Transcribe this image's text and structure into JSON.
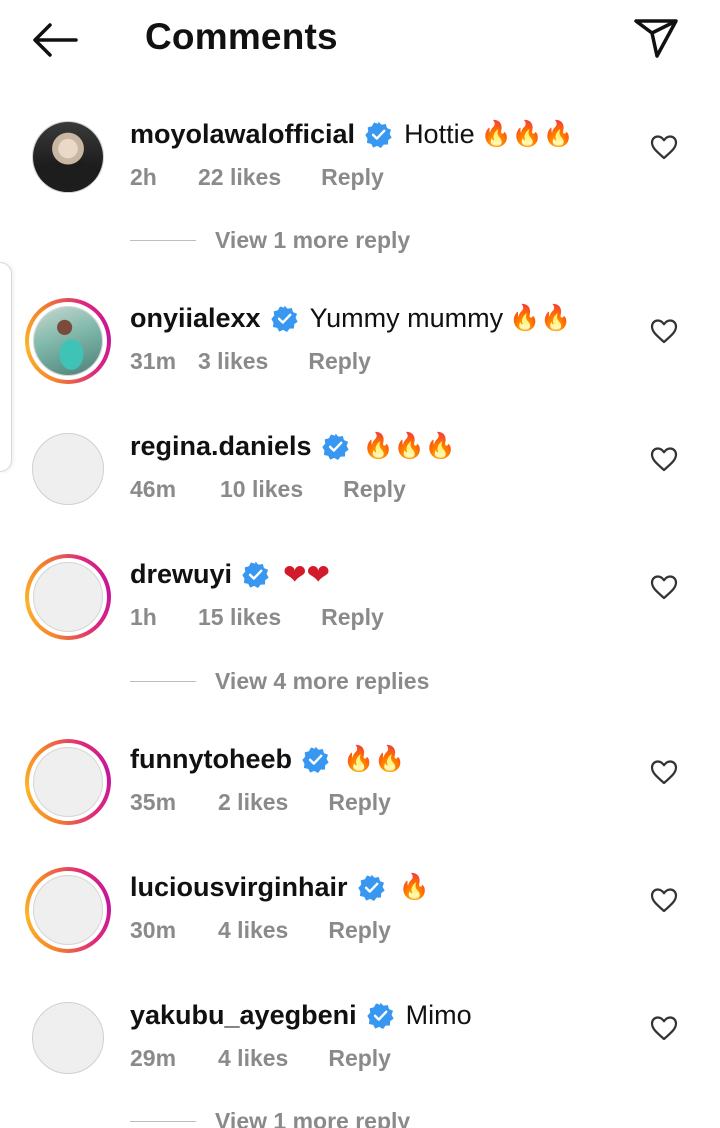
{
  "header": {
    "title": "Comments",
    "back_icon": "arrow-left-icon",
    "send_icon": "paper-plane-icon"
  },
  "colors": {
    "verified_badge": "#3897f0",
    "secondary_text": "#8a8a8a",
    "story_ring_start": "#f58529",
    "story_ring_end": "#c4159b"
  },
  "comments": [
    {
      "username": "moyolawalofficial",
      "verified": true,
      "text": "Hottie",
      "emoji": "🔥🔥🔥",
      "time": "2h",
      "likes": "22 likes",
      "reply": "Reply",
      "avatar": "photo",
      "story_ring": false
    },
    {
      "username": "onyiialexx",
      "verified": true,
      "text": "Yummy mummy",
      "emoji": "🔥🔥",
      "time": "31m",
      "likes": "3 likes",
      "reply": "Reply",
      "avatar": "photo",
      "story_ring": true
    },
    {
      "username": "regina.daniels",
      "verified": true,
      "text": "",
      "emoji": "🔥🔥🔥",
      "time": "46m",
      "likes": "10 likes",
      "reply": "Reply",
      "avatar": "blank",
      "story_ring": false
    },
    {
      "username": "drewuyi",
      "verified": true,
      "text": "",
      "emoji": "❤❤",
      "time": "1h",
      "likes": "15 likes",
      "reply": "Reply",
      "avatar": "blank",
      "story_ring": true
    },
    {
      "username": "funnytoheeb",
      "verified": true,
      "text": "",
      "emoji": "🔥🔥",
      "time": "35m",
      "likes": "2 likes",
      "reply": "Reply",
      "avatar": "blank",
      "story_ring": true
    },
    {
      "username": "luciousvirginhair",
      "verified": true,
      "text": "",
      "emoji": "🔥",
      "time": "30m",
      "likes": "4 likes",
      "reply": "Reply",
      "avatar": "blank",
      "story_ring": true
    },
    {
      "username": "yakubu_ayegbeni",
      "verified": true,
      "text": "Mimo",
      "emoji": "",
      "time": "29m",
      "likes": "4 likes",
      "reply": "Reply",
      "avatar": "blank",
      "story_ring": false
    }
  ],
  "view_replies": [
    {
      "label": "View 1 more reply"
    },
    {
      "label": "View 4 more replies"
    },
    {
      "label": "View 1 more reply"
    }
  ]
}
